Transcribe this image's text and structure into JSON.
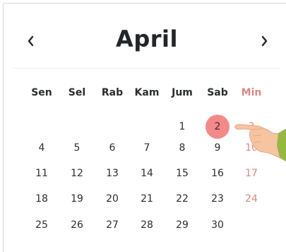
{
  "calendar": {
    "month": "April",
    "prev_label": "‹",
    "next_label": "›",
    "weekdays": [
      "Sen",
      "Sel",
      "Rab",
      "Kam",
      "Jum",
      "Sab",
      "Min"
    ],
    "weeks": [
      [
        "",
        "",
        "",
        "",
        "1",
        "2",
        "3"
      ],
      [
        "4",
        "5",
        "6",
        "7",
        "8",
        "9",
        "10"
      ],
      [
        "11",
        "12",
        "13",
        "14",
        "15",
        "16",
        "17"
      ],
      [
        "18",
        "19",
        "20",
        "21",
        "22",
        "23",
        "24"
      ],
      [
        "25",
        "26",
        "27",
        "28",
        "29",
        "30",
        ""
      ]
    ],
    "selected_day": "2",
    "colors": {
      "accent": "#f4898a",
      "weekend": "#d88a85",
      "text": "#2b2d31"
    },
    "icons": {
      "prev": "chevron-left-icon",
      "next": "chevron-right-icon",
      "pointer": "pointing-hand-icon"
    }
  }
}
